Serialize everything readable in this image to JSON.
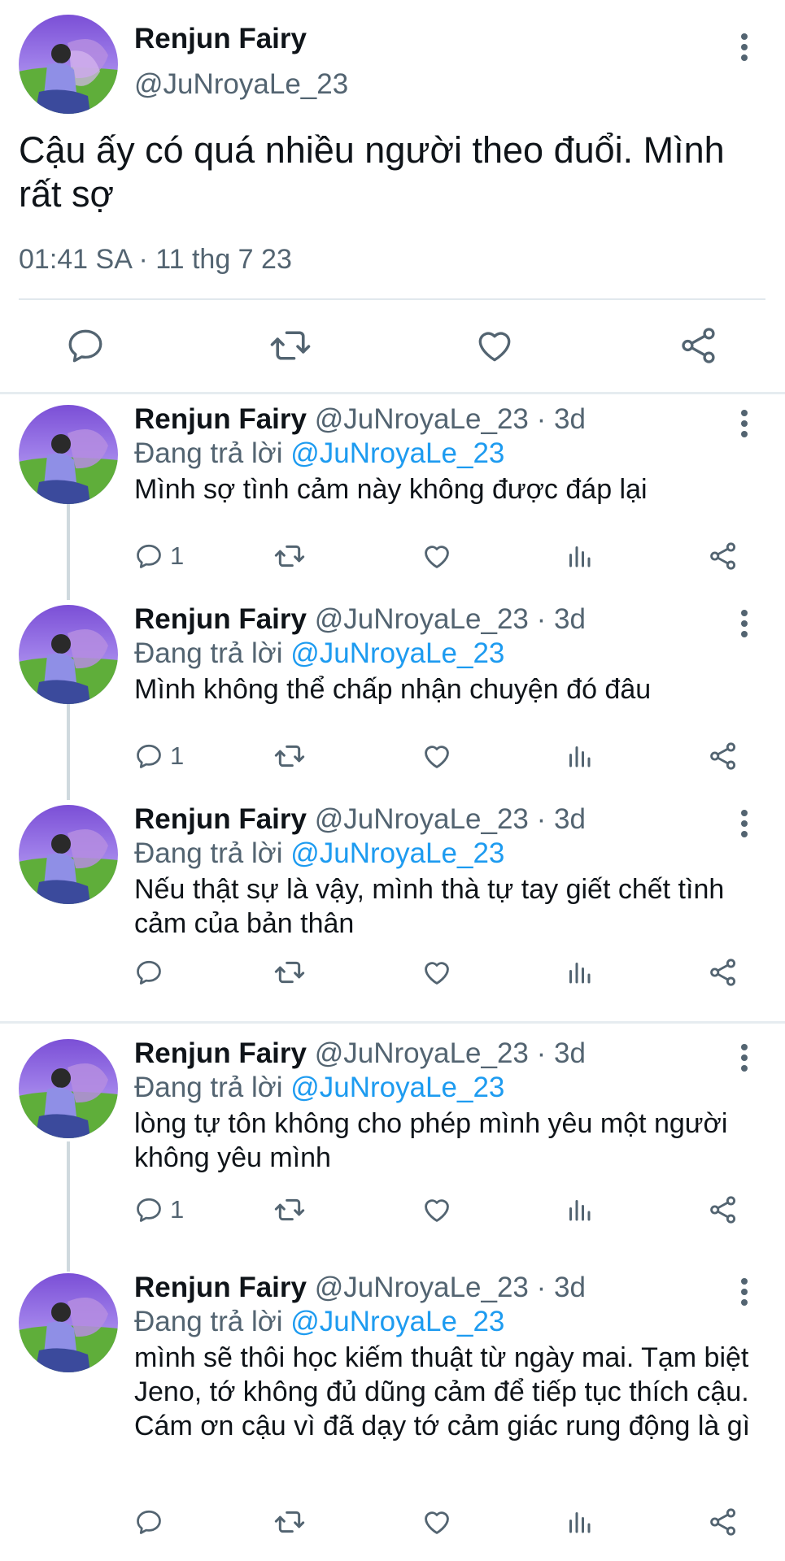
{
  "main_tweet": {
    "author_name": "Renjun Fairy",
    "author_handle": "@JuNroyaLe_23",
    "text": "Cậu ấy có quá nhiều người theo đuổi. Mình rất sợ",
    "timestamp": "01:41 SA · 11 thg 7 23",
    "actions": [
      "reply-icon",
      "retweet-icon",
      "like-icon",
      "share-icon"
    ]
  },
  "replies": [
    {
      "name": "Renjun Fairy",
      "handle": "@JuNroyaLe_23",
      "separator": "·",
      "age": "3d",
      "replying_label": "Đang trả lời",
      "replying_to": "@JuNroyaLe_23",
      "text": "Mình sợ tình cảm này không được đáp lại",
      "reply_count": "1"
    },
    {
      "name": "Renjun Fairy",
      "handle": "@JuNroyaLe_23",
      "separator": "·",
      "age": "3d",
      "replying_label": "Đang trả lời",
      "replying_to": "@JuNroyaLe_23",
      "text": "Mình không thể chấp nhận chuyện đó đâu",
      "reply_count": "1"
    },
    {
      "name": "Renjun Fairy",
      "handle": "@JuNroyaLe_23",
      "separator": "·",
      "age": "3d",
      "replying_label": "Đang trả lời",
      "replying_to": "@JuNroyaLe_23",
      "text": "Nếu thật sự là vậy, mình thà tự tay giết chết tình cảm của bản thân",
      "reply_count": ""
    },
    {
      "name": "Renjun Fairy",
      "handle": "@JuNroyaLe_23",
      "separator": "·",
      "age": "3d",
      "replying_label": "Đang trả lời",
      "replying_to": "@JuNroyaLe_23",
      "text": "lòng tự tôn không cho phép mình yêu một người không yêu mình",
      "reply_count": "1"
    },
    {
      "name": "Renjun Fairy",
      "handle": "@JuNroyaLe_23",
      "separator": "·",
      "age": "3d",
      "replying_label": "Đang trả lời",
      "replying_to": "@JuNroyaLe_23",
      "text": "mình sẽ thôi học kiếm thuật từ ngày mai. Tạm biệt Jeno, tớ không đủ dũng cảm để tiếp tục thích cậu. Cám ơn cậu vì đã dạy tớ cảm giác rung động là gì",
      "reply_count": ""
    }
  ],
  "colors": {
    "text": "#0f1419",
    "secondary": "#536471",
    "link": "#1d9bf0",
    "divider": "#e6ecf0",
    "thread_line": "#cfd9de"
  }
}
